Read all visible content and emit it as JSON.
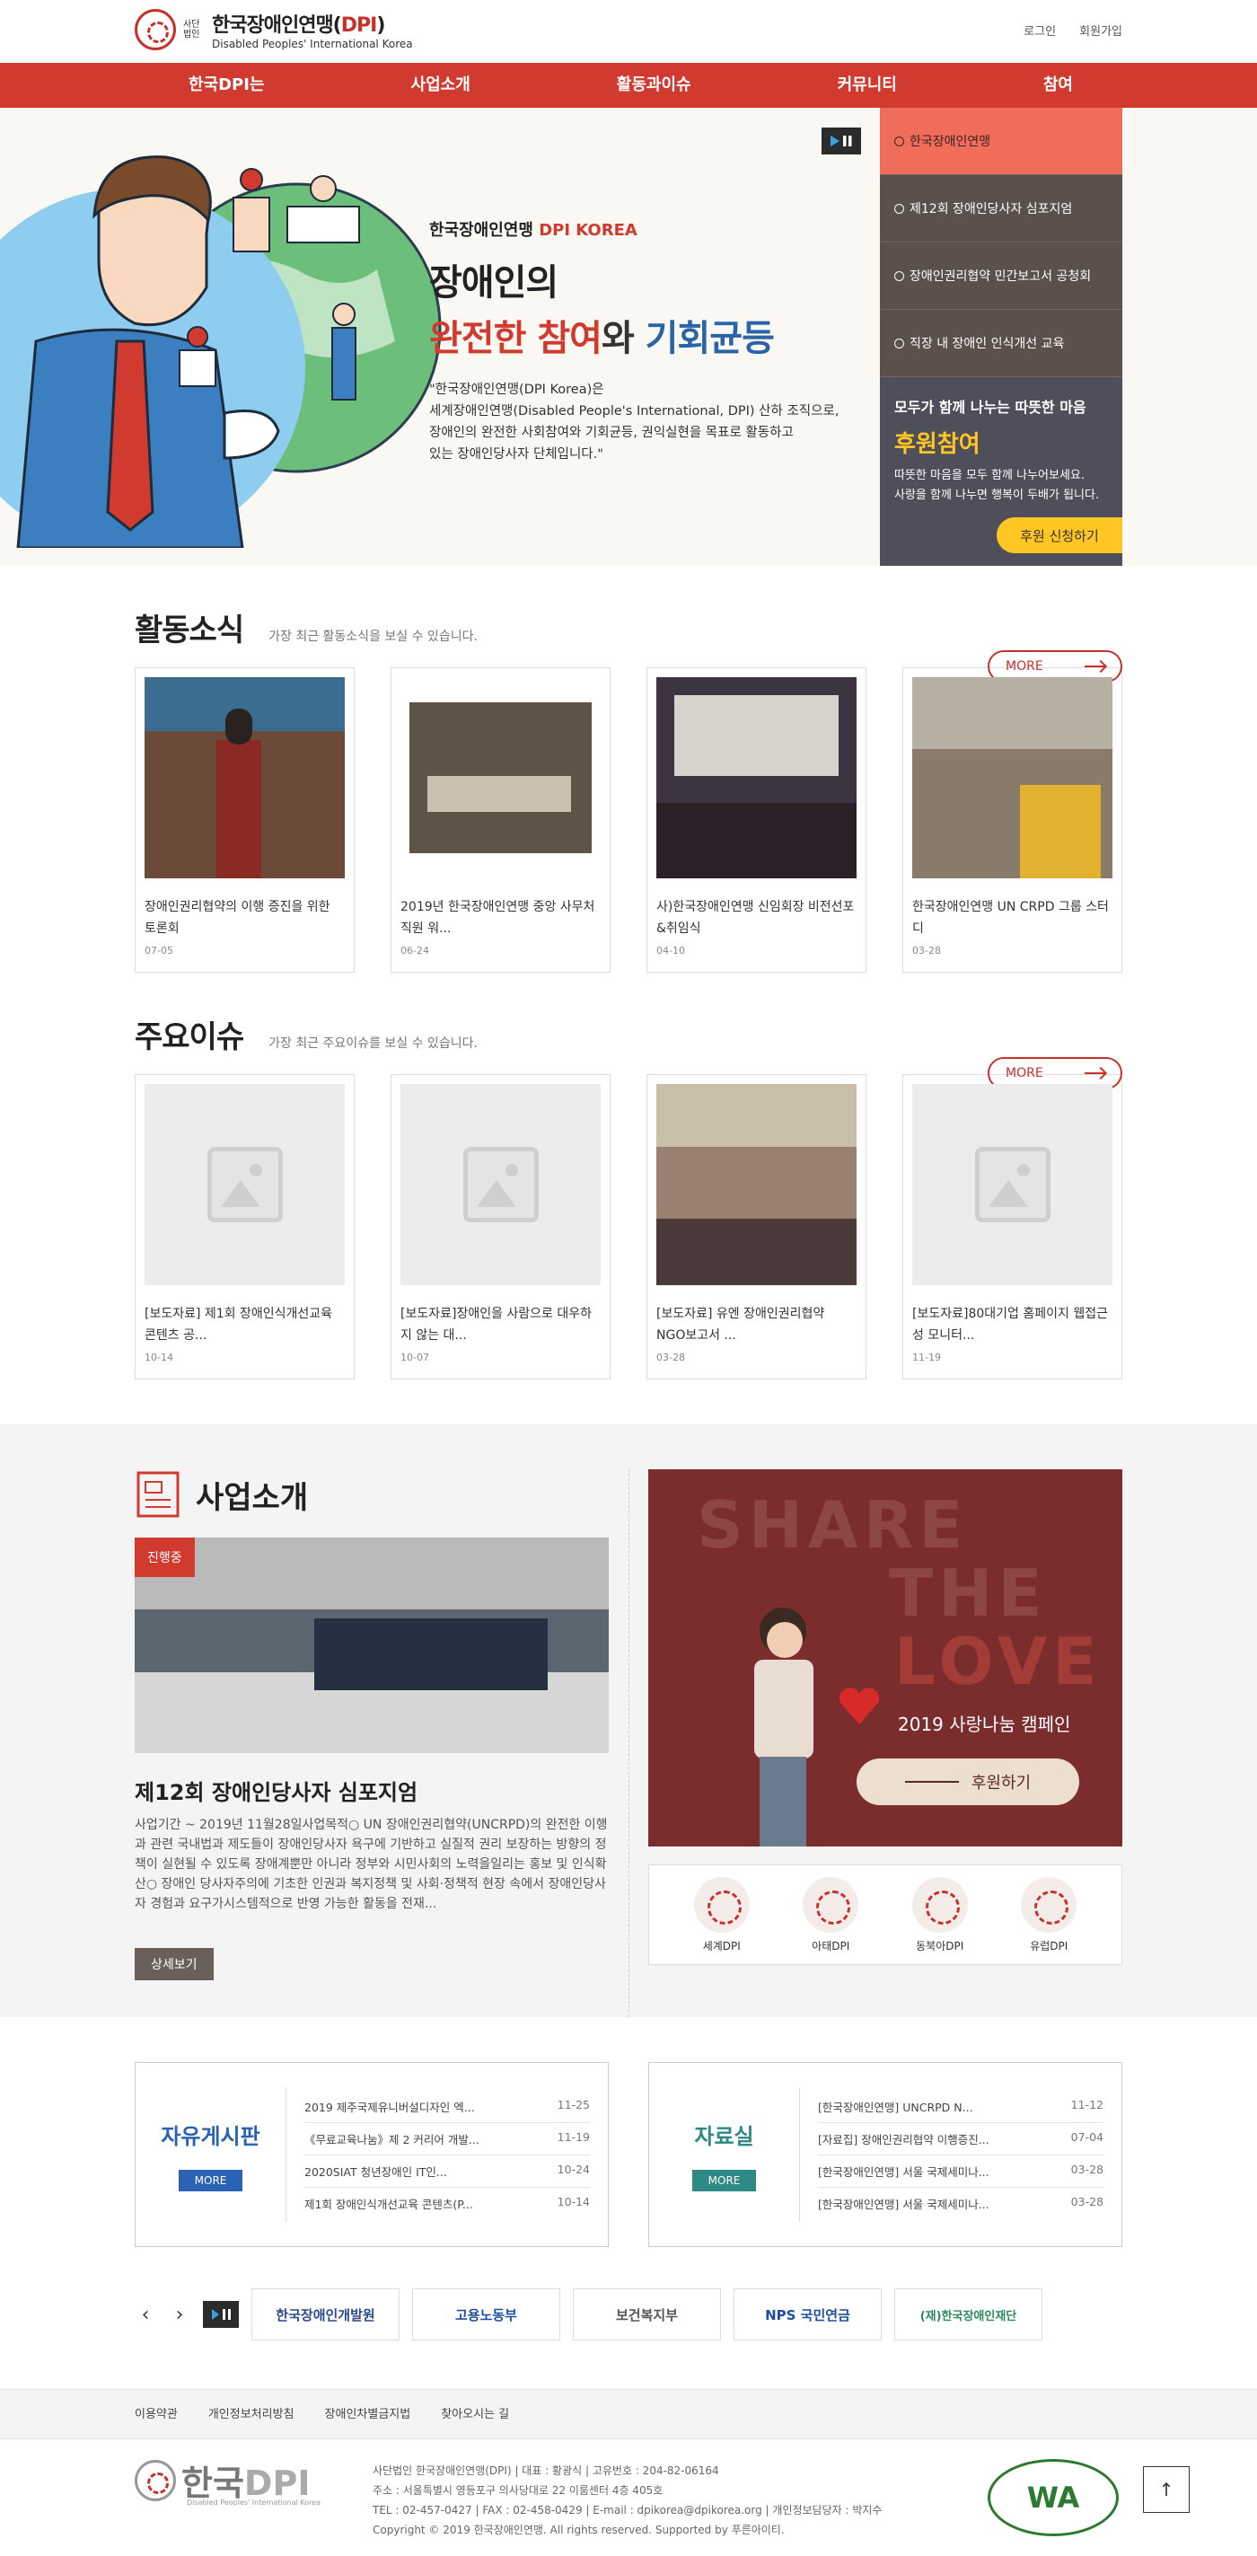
{
  "header": {
    "logo_small": "사단\n법인",
    "logo_ko_pre": "한국장애인연맹(",
    "logo_ko_dpi": "DPI",
    "logo_ko_post": ")",
    "logo_en": "Disabled Peoples' International Korea",
    "login": "로그인",
    "signup": "회원가입"
  },
  "nav": [
    "한국DPI는",
    "사업소개",
    "활동과이슈",
    "커뮤니티",
    "참여"
  ],
  "hero": {
    "sub_pre": "한국장애인연맹 ",
    "sub_red": "DPI KOREA",
    "line1": "장애인의",
    "line2_a": "완전한 참여",
    "line2_b": "와 ",
    "line2_c": "기회균등",
    "desc1": "\"한국장애인연맹(DPI Korea)은",
    "desc2": "세계장애인연맹(Disabled People's International, DPI) 산하 조직으로,",
    "desc3": "장애인의 완전한 사회참여와 기회균등, 권익실현을 목표로 활동하고",
    "desc4": "있는 장애인당사자 단체입니다.\""
  },
  "hero_side": {
    "items": [
      "한국장애인연맹",
      "제12회 장애인당사자 심포지엄",
      "장애인권리협약 민간보고서 공청회",
      "직장 내 장애인 인식개선 교육"
    ],
    "donate_t1": "모두가 함께 나누는 따뜻한 마음",
    "donate_t2": "후원참여",
    "donate_t3a": "따뜻한 마음을 모두 함께 나누어보세요.",
    "donate_t3b": "사랑을 함께 나누면 행복이 두배가 됩니다.",
    "donate_btn": "후원 신청하기"
  },
  "activity": {
    "title": "활동소식",
    "desc": "가장 최근 활동소식을 보실 수 있습니다.",
    "more": "MORE",
    "cards": [
      {
        "title": "장애인권리협약의 이행 증진을 위한 토론회",
        "date": "07-05"
      },
      {
        "title": "2019년 한국장애인연맹 중앙 사무처 직원 워...",
        "date": "06-24"
      },
      {
        "title": "사)한국장애인연맹 신임회장 비전선포&취임식",
        "date": "04-10"
      },
      {
        "title": "한국장애인연맹 UN CRPD 그룹 스터디",
        "date": "03-28"
      }
    ]
  },
  "issues": {
    "title": "주요이슈",
    "desc": "가장 최근 주요이슈를 보실 수 있습니다.",
    "more": "MORE",
    "cards": [
      {
        "title": "[보도자료] 제1회 장애인식개선교육 콘텐츠 공...",
        "date": "10-14"
      },
      {
        "title": "[보도자료]장애인을 사람으로 대우하지 않는 대...",
        "date": "10-07"
      },
      {
        "title": "[보도자료] 유엔 장애인권리협약 NGO보고서 ...",
        "date": "03-28"
      },
      {
        "title": "[보도자료]80대기업 홈페이지 웹접근성 모니터...",
        "date": "11-19"
      }
    ]
  },
  "business": {
    "title": "사업소개",
    "badge": "진행중",
    "item_title": "제12회 장애인당사자 심포지엄",
    "item_desc": "사업기간 ~ 2019년 11월28일사업목적○ UN 장애인권리협약(UNCRPD)의 완전한 이행과 관련 국내법과 제도들이 장애인당사자 욕구에 기반하고 실질적 권리 보장하는 방향의 정책이 실현될 수 있도록 장애계뿐만 아니라 정부와 시민사회의 노력을일리는 홍보 및 인식확산○ 장애인 당사자주의에 기초한 인권과 복지정책 및 사회·정책적 현장 속에서 장애인당사자 경험과 요구가시스템적으로 반영 가능한 활동을 전재...",
    "detail_btn": "상세보기",
    "campaign_w1": "SHARE",
    "campaign_w2": "THE",
    "campaign_w3": "LOVE",
    "campaign_title": "2019 사랑나눔 캠페인",
    "campaign_btn": "후원하기",
    "intl": [
      "세계DPI",
      "아태DPI",
      "동북아DPI",
      "유럽DPI"
    ]
  },
  "boards": {
    "free": {
      "name": "자유게시판",
      "more": "MORE",
      "color": "#2b63b4",
      "items": [
        {
          "t": "2019 제주국제유니버설디자인 엑...",
          "d": "11-25"
        },
        {
          "t": "《무료교육나눔》제 2 커리어 개발...",
          "d": "11-19"
        },
        {
          "t": "2020SIAT 청년장애인 IT인...",
          "d": "10-24"
        },
        {
          "t": "제1회 장애인식개선교육 콘텐츠(P...",
          "d": "10-14"
        }
      ]
    },
    "data": {
      "name": "자료실",
      "more": "MORE",
      "color": "#2e8a84",
      "items": [
        {
          "t": "[한국장애인연맹] UNCRPD N...",
          "d": "11-12"
        },
        {
          "t": "[자료집] 장애인권리협약 이행증진...",
          "d": "07-04"
        },
        {
          "t": "[한국장애인연맹] 서울 국제세미나...",
          "d": "03-28"
        },
        {
          "t": "[한국장애인연맹] 서울 국제세미나...",
          "d": "03-28"
        }
      ]
    }
  },
  "partners": [
    "한국장애인개발원",
    "고용노동부",
    "보건복지부",
    "NPS 국민연금",
    "(재)한국장애인재단"
  ],
  "footer": {
    "links": [
      "이용약관",
      "개인정보처리방침",
      "장애인차별금지법",
      "찾아오시는 길"
    ],
    "logo_a": "한국",
    "logo_b": "DPI",
    "logo_en": "Disabled Peoples' International Korea",
    "line1": "사단법인 한국장애인연맹(DPI)  |  대표 : 황광식  |  고유번호 : 204-82-06164",
    "line2": "주소 : 서울특별시 영등포구 의사당대로 22 이룸센터 4층 405호",
    "line3": "TEL : 02-457-0427  |  FAX : 02-458-0429  |  E-mail : dpikorea@dpikorea.org  |  개인정보담당자 : 박지수",
    "line4": "Copyright © 2019 한국장애인연맹. All rights reserved. Supported by 푸른아이티.",
    "wa": "WA",
    "totop": "↑"
  }
}
